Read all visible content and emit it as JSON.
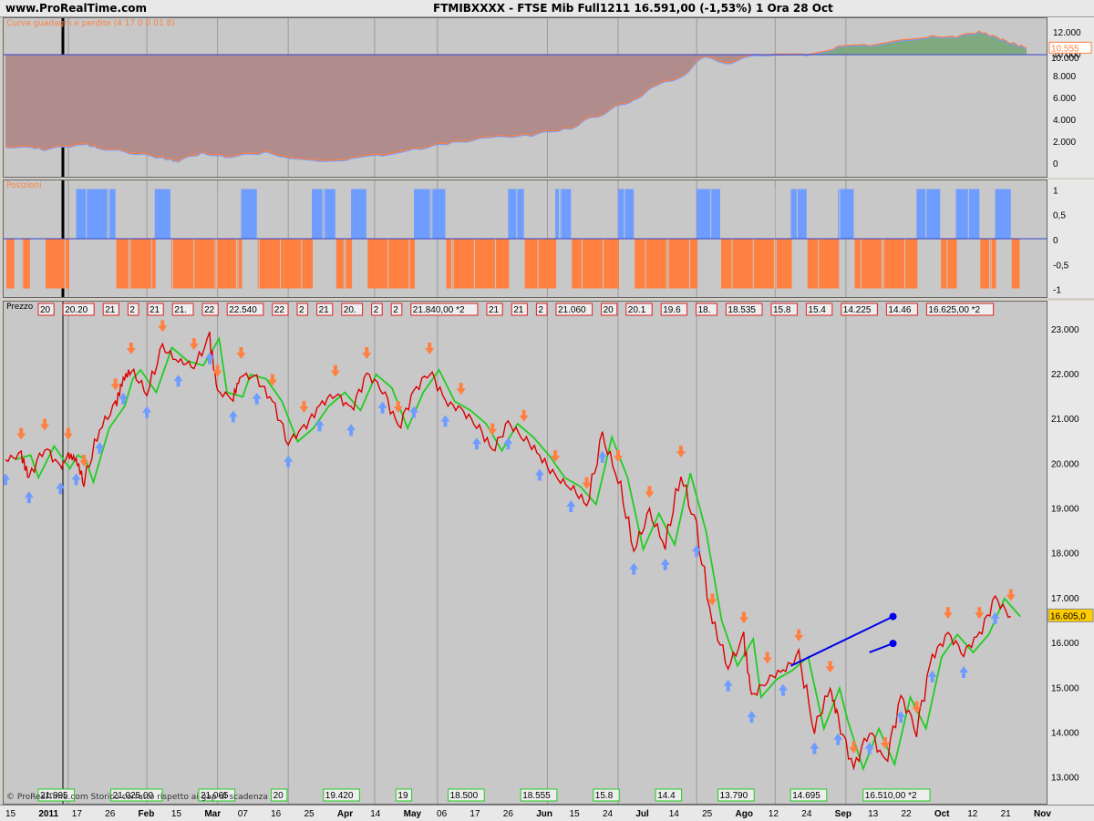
{
  "header": {
    "site": "www.ProRealTime.com",
    "title": "FTMIBXXXX - FTSE Mib Full1211   16.591,00 (-1,53%)   1 Ora  28 Oct"
  },
  "panels": {
    "equity_label": "Curva guadagni e perdite (4 17 0 0 01 8)",
    "positions_label": "Posizioni",
    "price_label": "Prezzo",
    "footer_note": "© ProRealTime.com  Storico corretto rispetto ai gap di scadenza"
  },
  "colors": {
    "loss_fill": "#b08c8c",
    "gain_fill": "#7faa7f",
    "long": "#6e9dff",
    "short": "#ff8040",
    "price": "#dd0000",
    "ma": "#22cc22",
    "ref_line": "#3344cc"
  },
  "chart_data": [
    {
      "type": "area",
      "name": "equity",
      "yticks": [
        "12.000",
        "10.000",
        "8.000",
        "6.000",
        "4.000",
        "2.000",
        "0"
      ],
      "ylim": [
        -500,
        13000
      ],
      "ref_value": 10000,
      "last_value_label": "10.555",
      "ref_label": "10.000",
      "points": [
        [
          0,
          1600
        ],
        [
          3,
          1600
        ],
        [
          5,
          1400
        ],
        [
          10,
          1900
        ],
        [
          12,
          1500
        ],
        [
          15,
          1200
        ],
        [
          20,
          600
        ],
        [
          22,
          300
        ],
        [
          25,
          1100
        ],
        [
          28,
          700
        ],
        [
          33,
          1100
        ],
        [
          36,
          700
        ],
        [
          40,
          300
        ],
        [
          44,
          500
        ],
        [
          48,
          900
        ],
        [
          52,
          1400
        ],
        [
          57,
          2000
        ],
        [
          62,
          2500
        ],
        [
          67,
          2700
        ],
        [
          72,
          3400
        ],
        [
          77,
          5000
        ],
        [
          80,
          6000
        ],
        [
          83,
          7200
        ],
        [
          86,
          8100
        ],
        [
          89,
          9800
        ],
        [
          92,
          9300
        ],
        [
          95,
          9900
        ],
        [
          98,
          10100
        ],
        [
          102,
          10000
        ],
        [
          106,
          10700
        ],
        [
          110,
          10900
        ],
        [
          114,
          11300
        ],
        [
          118,
          11700
        ],
        [
          121,
          11600
        ],
        [
          124,
          12100
        ],
        [
          126,
          11600
        ],
        [
          128,
          11100
        ],
        [
          130,
          10600
        ]
      ]
    },
    {
      "type": "bar",
      "name": "positions",
      "yticks": [
        "1",
        "0,5",
        "0",
        "-0,5",
        "-1"
      ],
      "ylim": [
        -1.1,
        1.1
      ],
      "long_blocks": [
        [
          9,
          14
        ],
        [
          19,
          21
        ],
        [
          30,
          32
        ],
        [
          39,
          42
        ],
        [
          44,
          46
        ],
        [
          52,
          56
        ],
        [
          64,
          66
        ],
        [
          70,
          72
        ],
        [
          78,
          80
        ],
        [
          88,
          91
        ],
        [
          100,
          102
        ],
        [
          106,
          108
        ],
        [
          116,
          119
        ],
        [
          121,
          124
        ],
        [
          126,
          128
        ]
      ],
      "short_blocks": [
        [
          0,
          1
        ],
        [
          2,
          3
        ],
        [
          5,
          8
        ],
        [
          14,
          19
        ],
        [
          21,
          30
        ],
        [
          32,
          39
        ],
        [
          42,
          44
        ],
        [
          46,
          52
        ],
        [
          56,
          64
        ],
        [
          66,
          70
        ],
        [
          72,
          78
        ],
        [
          80,
          88
        ],
        [
          91,
          100
        ],
        [
          102,
          106
        ],
        [
          108,
          116
        ],
        [
          119,
          121
        ],
        [
          124,
          126
        ],
        [
          128,
          129
        ]
      ]
    },
    {
      "type": "line",
      "name": "price",
      "yticks": [
        "23.000",
        "22.000",
        "21.000",
        "20.000",
        "19.000",
        "18.000",
        "17.000",
        "16.000",
        "15.000",
        "14.000",
        "13.000"
      ],
      "ylim": [
        12750,
        23300
      ],
      "last_value_label": "16.605,0",
      "xticks": [
        "15",
        "2011",
        "17",
        "26",
        "Feb",
        "15",
        "Mar",
        "07",
        "16",
        "25",
        "Apr",
        "14",
        "May",
        "06",
        "17",
        "26",
        "Jun",
        "15",
        "24",
        "Jul",
        "14",
        "25",
        "Ago",
        "12",
        "24",
        "Sep",
        "13",
        "22",
        "Oct",
        "12",
        "21",
        "Nov"
      ],
      "points": [
        [
          0,
          20100
        ],
        [
          2,
          20200
        ],
        [
          3,
          19700
        ],
        [
          5,
          20400
        ],
        [
          7,
          19900
        ],
        [
          8,
          20200
        ],
        [
          9,
          20100
        ],
        [
          10,
          19600
        ],
        [
          12,
          20800
        ],
        [
          14,
          21300
        ],
        [
          15,
          21900
        ],
        [
          16,
          22100
        ],
        [
          18,
          21600
        ],
        [
          20,
          22600
        ],
        [
          22,
          22300
        ],
        [
          24,
          22200
        ],
        [
          26,
          22800
        ],
        [
          27,
          21600
        ],
        [
          29,
          21500
        ],
        [
          30,
          22000
        ],
        [
          32,
          21900
        ],
        [
          34,
          21400
        ],
        [
          36,
          20500
        ],
        [
          38,
          20800
        ],
        [
          40,
          21300
        ],
        [
          42,
          21600
        ],
        [
          44,
          21200
        ],
        [
          46,
          22000
        ],
        [
          48,
          21700
        ],
        [
          50,
          20800
        ],
        [
          52,
          21600
        ],
        [
          54,
          22100
        ],
        [
          56,
          21400
        ],
        [
          58,
          21200
        ],
        [
          60,
          20900
        ],
        [
          62,
          20300
        ],
        [
          64,
          20900
        ],
        [
          66,
          20600
        ],
        [
          68,
          20200
        ],
        [
          70,
          19700
        ],
        [
          72,
          19500
        ],
        [
          74,
          19100
        ],
        [
          76,
          20600
        ],
        [
          78,
          19700
        ],
        [
          80,
          18100
        ],
        [
          82,
          18900
        ],
        [
          84,
          18200
        ],
        [
          86,
          19800
        ],
        [
          88,
          18500
        ],
        [
          90,
          16500
        ],
        [
          92,
          15500
        ],
        [
          94,
          16100
        ],
        [
          95,
          14800
        ],
        [
          97,
          15200
        ],
        [
          99,
          15400
        ],
        [
          101,
          15700
        ],
        [
          103,
          14100
        ],
        [
          105,
          15000
        ],
        [
          106,
          14300
        ],
        [
          108,
          13200
        ],
        [
          110,
          14100
        ],
        [
          112,
          13300
        ],
        [
          114,
          14800
        ],
        [
          116,
          14100
        ],
        [
          118,
          15700
        ],
        [
          120,
          16200
        ],
        [
          122,
          15800
        ],
        [
          124,
          16200
        ],
        [
          126,
          17000
        ],
        [
          128,
          16600
        ]
      ],
      "long_trades": [
        [
          100,
          15500,
          113,
          16600
        ],
        [
          110,
          15800,
          113,
          16000
        ]
      ],
      "top_strip": [
        "20",
        "20.20",
        "21",
        "2",
        "21",
        "21.",
        "22",
        "22.540",
        "22",
        "2",
        "21",
        "20.",
        "2",
        "2",
        "21.840,00 *2",
        "21",
        "21",
        "2",
        "21.060",
        "20",
        "20.1",
        "19.6",
        "18.",
        "18.535",
        "15.8",
        "15.4",
        "14.225",
        "14.46",
        "16.625,00 *2"
      ],
      "bottom_strip": [
        "21.895",
        "21.025,00",
        "21.065",
        "20",
        "19.420",
        "19",
        "18.500",
        "18.555",
        "15.8",
        "14.4",
        "13.790",
        "14.695",
        "16.510,00 *2"
      ]
    }
  ]
}
